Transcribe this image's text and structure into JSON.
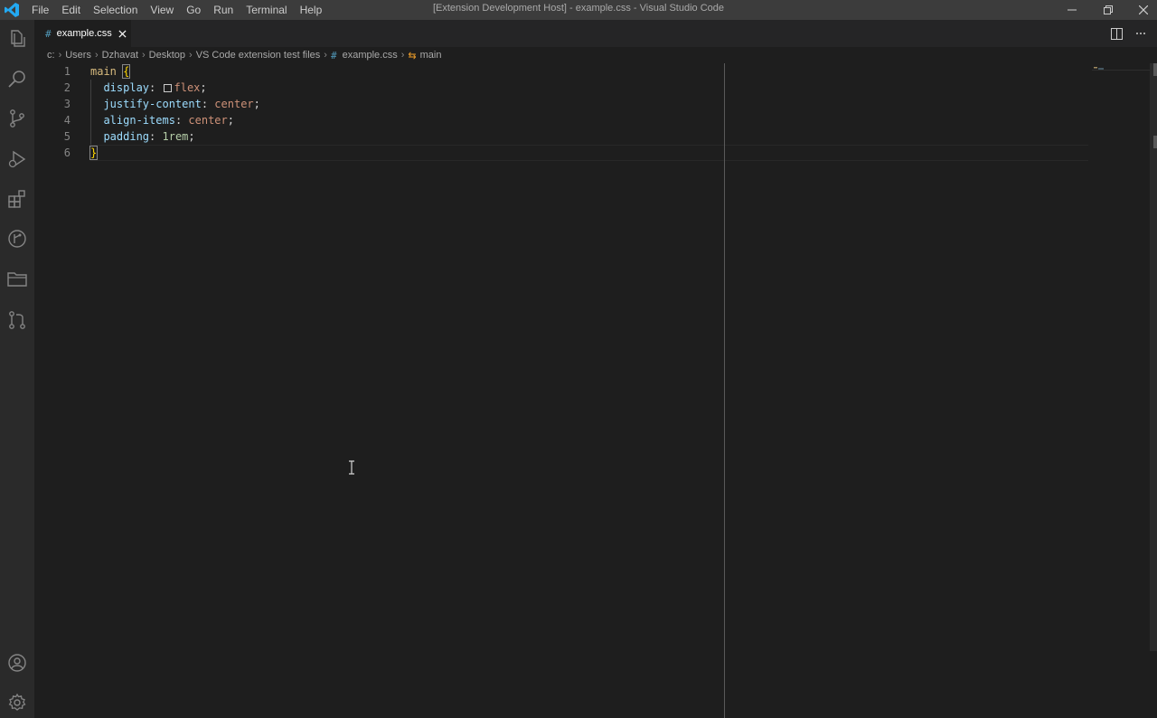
{
  "titlebar": {
    "menu": [
      "File",
      "Edit",
      "Selection",
      "View",
      "Go",
      "Run",
      "Terminal",
      "Help"
    ],
    "window_title": "[Extension Development Host] - example.css - Visual Studio Code"
  },
  "activity_bar": {
    "icons": [
      "explorer-icon",
      "search-icon",
      "source-control-icon",
      "run-debug-icon",
      "extensions-icon",
      "git-graph-icon",
      "folder-icon",
      "pull-request-icon",
      "account-icon",
      "settings-gear-icon"
    ]
  },
  "tabs": [
    {
      "icon": "#",
      "label": "example.css",
      "active": true
    }
  ],
  "breadcrumb": {
    "parts": [
      "c:",
      "Users",
      "Dzhavat",
      "Desktop",
      "VS Code extension test files"
    ],
    "file_icon": "#",
    "file": "example.css",
    "symbol_icon": "⇆",
    "symbol": "main"
  },
  "editor": {
    "line_numbers": [
      "1",
      "2",
      "3",
      "4",
      "5",
      "6"
    ],
    "line1": {
      "selector": "main",
      "brace": "{"
    },
    "line2": {
      "prop": "display",
      "colon": ":",
      "val": "flex",
      "semi": ";"
    },
    "line3": {
      "prop": "justify-content",
      "colon": ":",
      "val": "center",
      "semi": ";"
    },
    "line4": {
      "prop": "align-items",
      "colon": ":",
      "val": "center",
      "semi": ";"
    },
    "line5": {
      "prop": "padding",
      "colon": ":",
      "val": "1rem",
      "semi": ";"
    },
    "line6": {
      "brace": "}"
    }
  },
  "colors": {
    "titlebar_bg": "#3c3c3c",
    "activity_bg": "#2a2a2a",
    "editor_bg": "#1e1e1e",
    "css_icon": "#519aba",
    "symbol_icon": "#ee9d28"
  }
}
